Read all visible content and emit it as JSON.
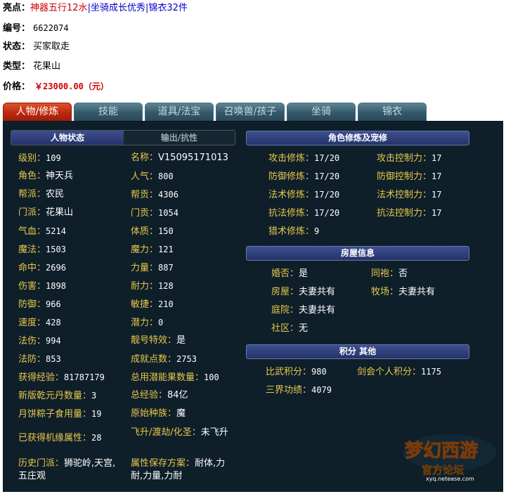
{
  "header": {
    "highlights_label": "亮点：",
    "highlights": [
      "神器五行12水",
      "坐骑成长优秀",
      "锦衣32件"
    ],
    "separator": "|",
    "id_label": "编号：",
    "id_value": "6622074",
    "status_label": "状态：",
    "status_value": "买家取走",
    "type_label": "类型：",
    "type_value": "花果山",
    "price_label": "价格：",
    "price_value": "￥23000.00（元）"
  },
  "tabs": [
    "人物/修炼",
    "技能",
    "道具/法宝",
    "召唤兽/孩子",
    "坐骑",
    "锦衣"
  ],
  "active_tab": 0,
  "char_panel": {
    "subtabs": [
      "人物状态",
      "输出/抗性"
    ],
    "left": [
      {
        "k": "级别：",
        "v": "109"
      },
      {
        "k": "角色：",
        "v": "神天兵"
      },
      {
        "k": "帮派：",
        "v": "农民"
      },
      {
        "k": "门派：",
        "v": "花果山"
      },
      {
        "k": "气血：",
        "v": "5214"
      },
      {
        "k": "魔法：",
        "v": "1503"
      },
      {
        "k": "命中：",
        "v": "2696"
      },
      {
        "k": "伤害：",
        "v": "1898"
      },
      {
        "k": "防御：",
        "v": "966"
      },
      {
        "k": "速度：",
        "v": "428"
      },
      {
        "k": "法伤：",
        "v": "994"
      },
      {
        "k": "法防：",
        "v": "853"
      },
      {
        "k": "获得经验：",
        "v": "81787179"
      },
      {
        "k": "新版乾元丹数量：",
        "v": "3"
      },
      {
        "k": "月饼粽子食用量：",
        "v": "19"
      },
      {
        "k": "已获得机缘属性：",
        "v": "28"
      },
      {
        "k": "历史门派：",
        "v": "狮驼岭,天宫,五庄观"
      }
    ],
    "right": [
      {
        "k": "名称：",
        "v": "V15095171013"
      },
      {
        "k": "人气：",
        "v": "800"
      },
      {
        "k": "帮贡：",
        "v": "4306"
      },
      {
        "k": "门贡：",
        "v": "1054"
      },
      {
        "k": "体质：",
        "v": "150"
      },
      {
        "k": "魔力：",
        "v": "121"
      },
      {
        "k": "力量：",
        "v": "887"
      },
      {
        "k": "耐力：",
        "v": "128"
      },
      {
        "k": "敏捷：",
        "v": "210"
      },
      {
        "k": "潜力：",
        "v": "0"
      },
      {
        "k": "靓号特效：",
        "v": "是"
      },
      {
        "k": "成就点数：",
        "v": "2753"
      },
      {
        "k": "总用潜能果数量：",
        "v": "100"
      },
      {
        "k": "总经验：",
        "v": "84亿"
      },
      {
        "k": "原始种族：",
        "v": "魔"
      },
      {
        "k": "飞升/渡劫/化圣：",
        "v": "未飞升"
      },
      {
        "k": "属性保存方案：",
        "v": "耐体,力耐,力量,力耐"
      }
    ]
  },
  "cultivation": {
    "title": "角色修炼及宠修",
    "left": [
      {
        "k": "攻击修炼：",
        "v": "17/20"
      },
      {
        "k": "防御修炼：",
        "v": "17/20"
      },
      {
        "k": "法术修炼：",
        "v": "17/20"
      },
      {
        "k": "抗法修炼：",
        "v": "17/20"
      },
      {
        "k": "猎术修炼：",
        "v": "9"
      }
    ],
    "right": [
      {
        "k": "攻击控制力：",
        "v": "17"
      },
      {
        "k": "防御控制力：",
        "v": "17"
      },
      {
        "k": "法术控制力：",
        "v": "17"
      },
      {
        "k": "抗法控制力：",
        "v": "17"
      }
    ]
  },
  "house": {
    "title": "房屋信息",
    "items": [
      {
        "k": "婚否：",
        "v": "是"
      },
      {
        "k": "同袍：",
        "v": "否"
      },
      {
        "k": "房屋：",
        "v": "夫妻共有"
      },
      {
        "k": "牧场：",
        "v": "夫妻共有"
      },
      {
        "k": "庭院：",
        "v": "夫妻共有"
      },
      {
        "k": "社区：",
        "v": "无"
      }
    ]
  },
  "points": {
    "title": "积分 其他",
    "items": [
      {
        "k": "比武积分：",
        "v": "980"
      },
      {
        "k": "剑会个人积分：",
        "v": "1175"
      },
      {
        "k": "三界功绩：",
        "v": "4079"
      }
    ]
  },
  "logo": {
    "text": "梦幻西游",
    "sub": "官方论坛",
    "url": "xyq.netease.com"
  },
  "colors": {
    "panel_bg": "#0e1f2a",
    "key": "#e8c84a",
    "value": "#ffffff",
    "tab_active": "#b8260d",
    "tab": "#33586a",
    "header": "#2d3c78"
  }
}
